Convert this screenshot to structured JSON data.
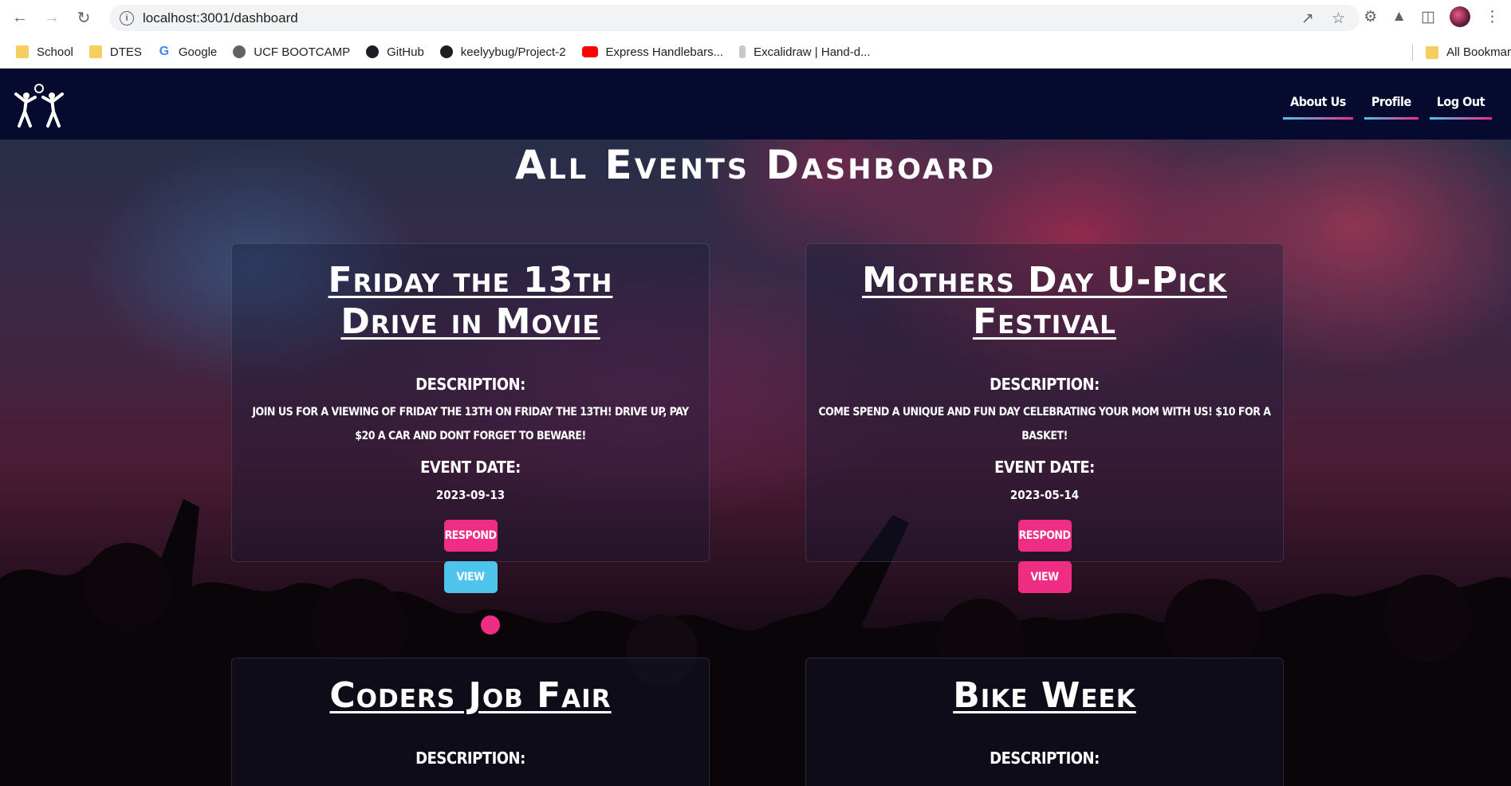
{
  "browser": {
    "url": "localhost:3001/dashboard",
    "bookmarks": [
      {
        "label": "School",
        "icon": "folder-icon"
      },
      {
        "label": "DTES",
        "icon": "folder-icon"
      },
      {
        "label": "Google",
        "icon": "google-icon"
      },
      {
        "label": "UCF BOOTCAMP",
        "icon": "globe-icon"
      },
      {
        "label": "GitHub",
        "icon": "github-icon"
      },
      {
        "label": "keelyybug/Project-2",
        "icon": "github-icon"
      },
      {
        "label": "Express Handlebars...",
        "icon": "youtube-icon"
      },
      {
        "label": "Excalidraw | Hand-d...",
        "icon": "excalidraw-icon"
      }
    ],
    "all_bookmarks": "All Bookmar"
  },
  "site": {
    "nav": [
      "About Us",
      "Profile",
      "Log Out"
    ],
    "page_title": "All Events Dashboard",
    "description_label": "Description:",
    "event_date_label": "Event Date:",
    "respond_label": "Respond",
    "view_label": "View"
  },
  "events": [
    {
      "title": "Friday the 13th Drive in Movie",
      "description": "Join us for a viewing of Friday the 13th on Friday the 13th! Drive up, pay $20 a car and dont forget to beware!",
      "date": "2023-09-13"
    },
    {
      "title": "Mothers Day U-Pick Festival",
      "description": "Come spend a unique and fun day celebrating your mom with us! $10 for a basket!",
      "date": "2023-05-14"
    },
    {
      "title": "Coders Job Fair"
    },
    {
      "title": "Bike Week"
    }
  ],
  "colors": {
    "header_bg": "#050a2e",
    "accent_pink": "#ef2d84",
    "accent_cyan": "#4ec4ec"
  }
}
